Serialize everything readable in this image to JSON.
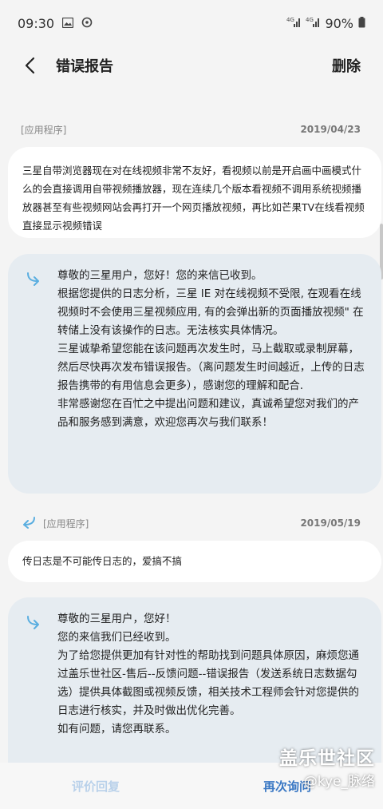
{
  "status_bar": {
    "time": "09:30",
    "signal_text": "4G",
    "battery": "90%"
  },
  "header": {
    "title": "错误报告",
    "delete_label": "删除",
    "back_icon": "chevron-left-icon"
  },
  "messages": [
    {
      "type": "user",
      "tag": "[应用程序]",
      "date": "2019/04/23",
      "text": "三星自带浏览器现在对在线视频非常不友好，看视频以前是开启画中画模式什么的会直接调用自带视频播放器，现在连续几个版本看视频不调用系统视频播放器甚至有些视频网站会再打开一个网页播放视频，再比如芒果TV在线看视频直接显示视频错误"
    },
    {
      "type": "reply",
      "paragraphs": [
        "尊敬的三星用户，您好！您的来信已收到。",
        "根据您提供的日志分析，三星 IE 对在线视频不受限, 在观看在线视频时不会使用三星视频应用, 有的会弹出新的页面播放视频\" 在转储上没有该操作的日志。无法核实具体情况。",
        "三星诚挚希望您能在该问题再次发生时，马上截取或录制屏幕，然后尽快再次发布错误报告。（离问题发生时间越近，上传的日志报告携带的有用信息会更多），感谢您的理解和配合.",
        "非常感谢您在百忙之中提出问题和建议，真诚希望您对我们的产品和服务感到满意，欢迎您再次与我们联系！"
      ]
    },
    {
      "type": "user",
      "tag": "[应用程序]",
      "date": "2019/05/19",
      "text": "传日志是不可能传日志的，爱搞不搞"
    },
    {
      "type": "reply",
      "paragraphs": [
        "尊敬的三星用户，您好！",
        "您的来信我们已经收到。",
        "为了给您提供更加有针对性的帮助找到问题具体原因，麻烦您通过盖乐世社区-售后--反馈问题--错误报告（发送系统日志数据勾选）提供具体截图或视频反馈，相关技术工程师会针对您提供的日志进行核实，并及时做出优化完善。",
        "如有问题，请您再联系。"
      ]
    }
  ],
  "bottom_bar": {
    "rate_label": "评价回复",
    "ask_again_label": "再次询问"
  },
  "watermark": {
    "line1": "盖乐世社区",
    "line2": "@kye_脉络"
  },
  "colors": {
    "reply_bg": "#e6ecf1",
    "reply_icon": "#5aaee0",
    "accent_blue": "#3a78c4",
    "disabled_blue": "#b9d1ea"
  }
}
